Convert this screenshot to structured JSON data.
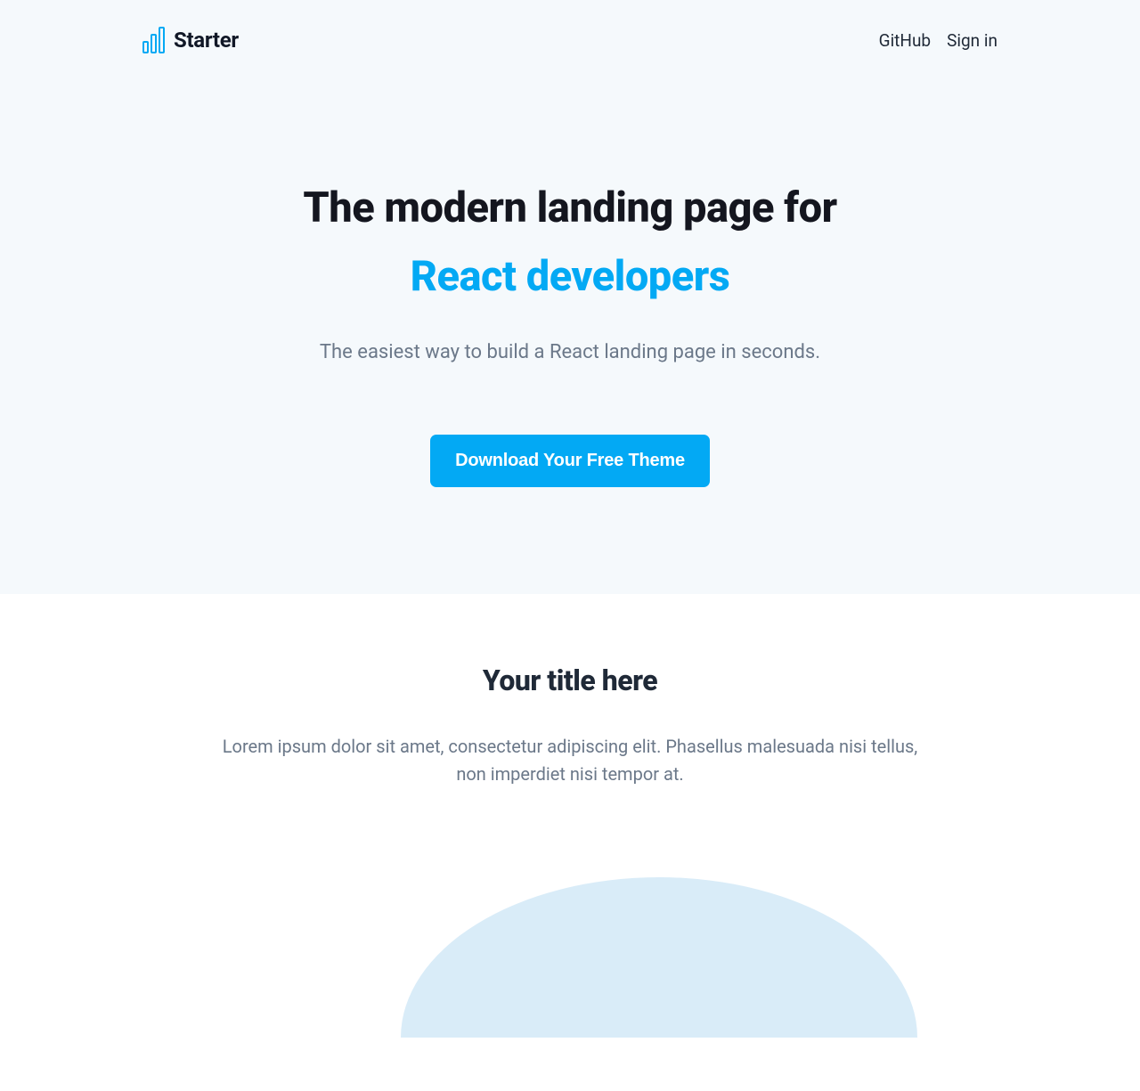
{
  "header": {
    "logo_text": "Starter",
    "nav": {
      "github": "GitHub",
      "signin": "Sign in"
    }
  },
  "hero": {
    "title_line1": "The modern landing page for",
    "title_line2": "React developers",
    "subtitle": "The easiest way to build a React landing page in seconds.",
    "cta_label": "Download Your Free Theme"
  },
  "features": {
    "title": "Your title here",
    "subtitle": "Lorem ipsum dolor sit amet, consectetur adipiscing elit. Phasellus malesuada nisi tellus, non imperdiet nisi tempor at."
  },
  "colors": {
    "accent": "#03a9f4",
    "hero_bg": "#f5f9fc",
    "text_dark": "#111827",
    "text_muted": "#6b7889"
  }
}
